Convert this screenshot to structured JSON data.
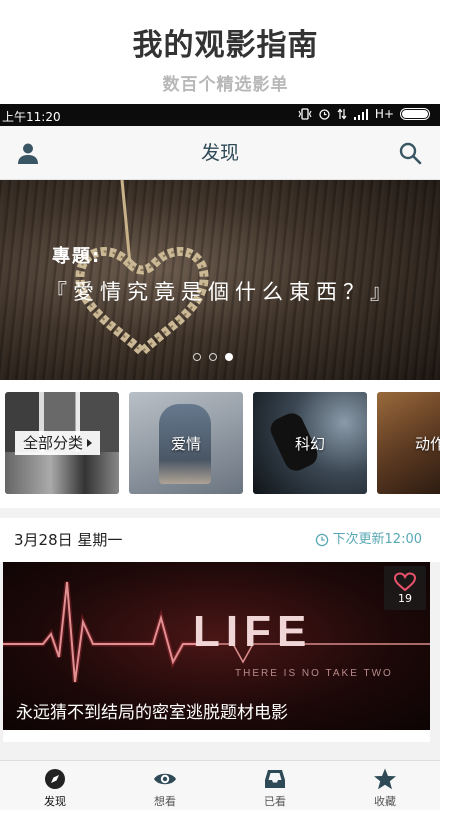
{
  "promo": {
    "title": "我的观影指南",
    "subtitle": "数百个精选影单"
  },
  "status_bar": {
    "time": "上午11:20",
    "network": "H+"
  },
  "nav": {
    "title": "发现",
    "user_icon": "user-icon",
    "search_icon": "search-icon"
  },
  "banner": {
    "label": "專題:",
    "text": "『愛情究竟是個什么東西？』",
    "page_count": 3,
    "active_page": 3
  },
  "categories": [
    {
      "label": "全部分类"
    },
    {
      "label": "爱情"
    },
    {
      "label": "科幻"
    },
    {
      "label": "动作"
    }
  ],
  "dateline": {
    "date": "3月28日 星期一",
    "next_update": "下次更新12:00"
  },
  "feature_card": {
    "title": "永远猜不到结局的密室逃脱题材电影",
    "like_count": "19",
    "art_text": "LIFE",
    "art_subtext": "THERE IS NO TAKE TWO"
  },
  "tabs": [
    {
      "label": "发现",
      "icon": "compass-icon",
      "active": true
    },
    {
      "label": "想看",
      "icon": "eye-icon",
      "active": false
    },
    {
      "label": "已看",
      "icon": "inbox-icon",
      "active": false
    },
    {
      "label": "收藏",
      "icon": "star-icon",
      "active": false
    }
  ],
  "colors": {
    "accent": "#57a7b4",
    "nav_title": "#2f4a57",
    "heart_like": "#e8526a"
  }
}
